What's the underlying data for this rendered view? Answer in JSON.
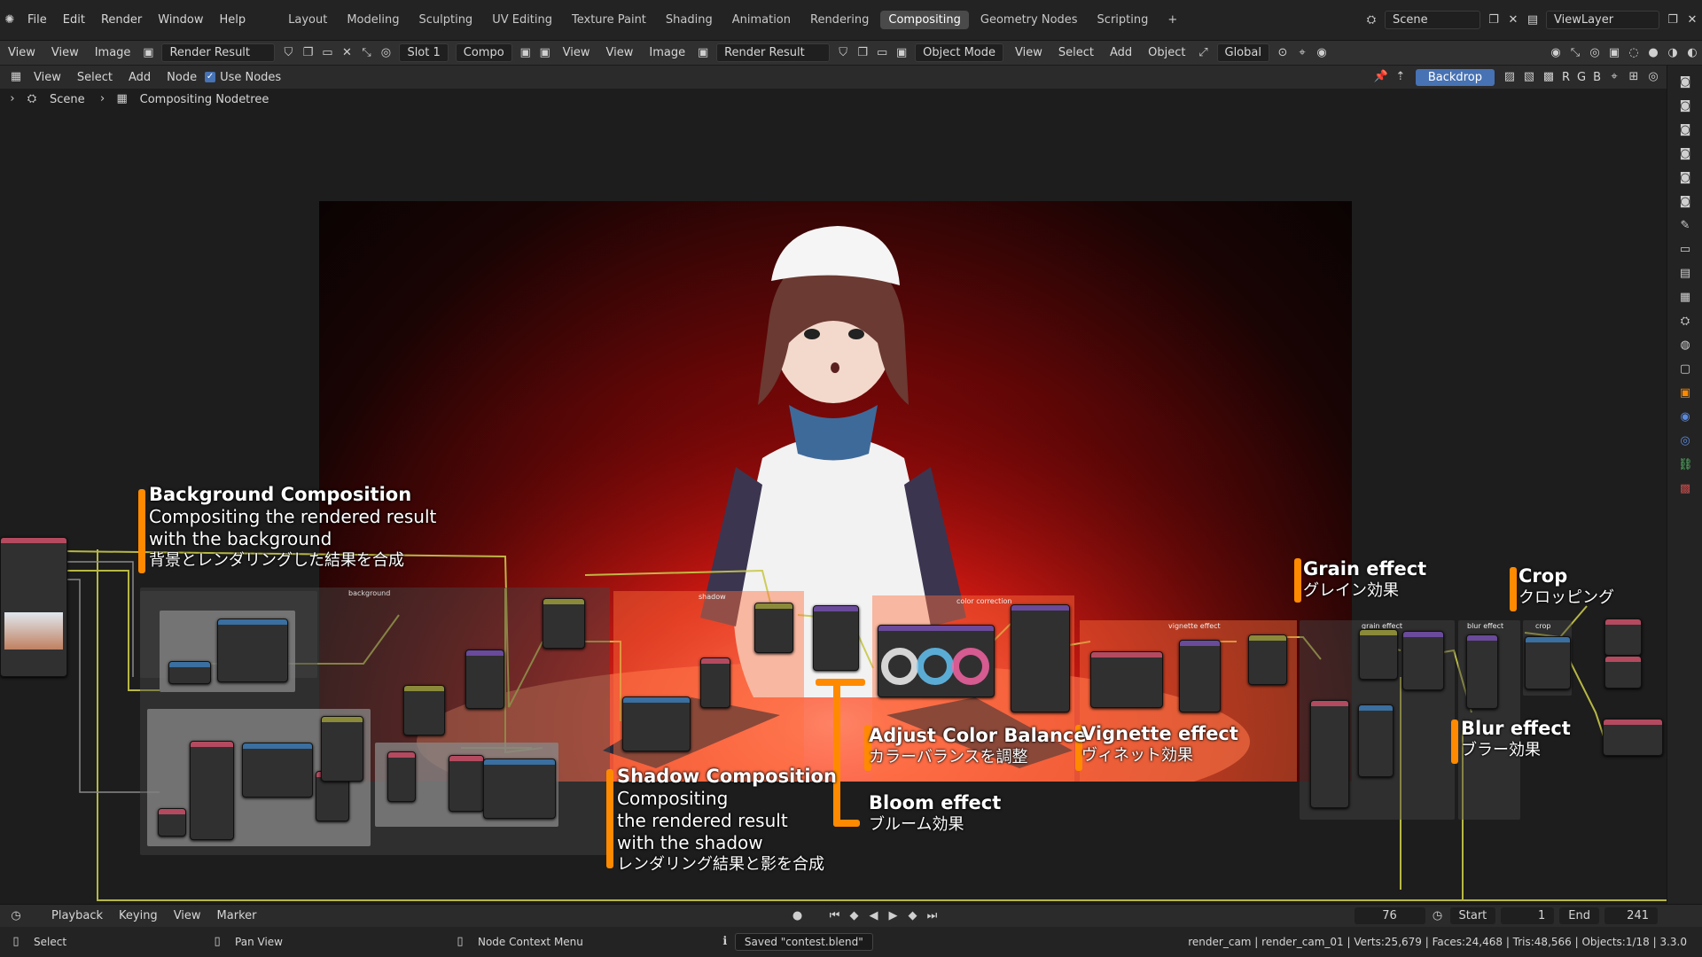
{
  "topbar": {
    "menu": [
      "File",
      "Edit",
      "Render",
      "Window",
      "Help"
    ],
    "workspaces": [
      "Layout",
      "Modeling",
      "Sculpting",
      "UV Editing",
      "Texture Paint",
      "Shading",
      "Animation",
      "Rendering",
      "Compositing",
      "Geometry Nodes",
      "Scripting"
    ],
    "active_workspace": "Compositing",
    "add_tab": "+",
    "scene": "Scene",
    "view_layer": "ViewLayer"
  },
  "header2": {
    "left_view": "View",
    "view": "View",
    "image": "Image",
    "render_result": "Render Result",
    "slot": "Slot 1",
    "compo": "Compo",
    "view2": "View",
    "view3": "View",
    "image2": "Image",
    "render_result2": "Render Result",
    "object_mode": "Object Mode",
    "view4": "View",
    "select": "Select",
    "add": "Add",
    "object": "Object",
    "global": "Global"
  },
  "header3": {
    "view": "View",
    "select": "Select",
    "add": "Add",
    "node": "Node",
    "use_nodes": "Use Nodes",
    "backdrop": "Backdrop",
    "channels": [
      "R",
      "G",
      "B"
    ]
  },
  "breadcrumb": {
    "scene": "Scene",
    "nodetree": "Compositing Nodetree"
  },
  "annotations": {
    "background": {
      "title": "Background Composition",
      "line1": "Compositing the rendered result",
      "line2": "with the background",
      "jp": "背景とレンダリングした結果を合成"
    },
    "shadow": {
      "title": "Shadow Composition",
      "line1": "Compositing",
      "line2": "the rendered result",
      "line3": "with the shadow",
      "jp": "レンダリング結果と影を合成"
    },
    "color_balance": {
      "title": "Adjust Color Balance",
      "jp": "カラーバランスを調整"
    },
    "bloom": {
      "title": "Bloom effect",
      "jp": "ブルーム効果"
    },
    "vignette": {
      "title": "Vignette effect",
      "jp": "ヴィネット効果"
    },
    "grain": {
      "title": "Grain effect",
      "jp": "グレイン効果"
    },
    "crop": {
      "title": "Crop",
      "jp": "クロッピング"
    },
    "blur": {
      "title": "Blur effect",
      "jp": "ブラー効果"
    }
  },
  "frame_labels": {
    "background": "background",
    "shadow": "shadow",
    "color_correction": "color correction",
    "vignette": "vignette effect",
    "grain": "grain effect",
    "blur": "blur effect",
    "crop": "crop"
  },
  "timeline": {
    "playback": "Playback",
    "keying": "Keying",
    "view": "View",
    "marker": "Marker",
    "current_frame": "76",
    "start_label": "Start",
    "start": "1",
    "end_label": "End",
    "end": "241"
  },
  "statusbar": {
    "select": "Select",
    "pan_view": "Pan View",
    "node_context_menu": "Node Context Menu",
    "saved": "Saved \"contest.blend\"",
    "stats": "render_cam | render_cam_01 | Verts:25,679 | Faces:24,468 | Tris:48,566 | Objects:1/18 | 3.3.0"
  },
  "colors": {
    "accent": "#4772b3",
    "orange": "#ff8a00",
    "wire": "#c8c84a"
  }
}
